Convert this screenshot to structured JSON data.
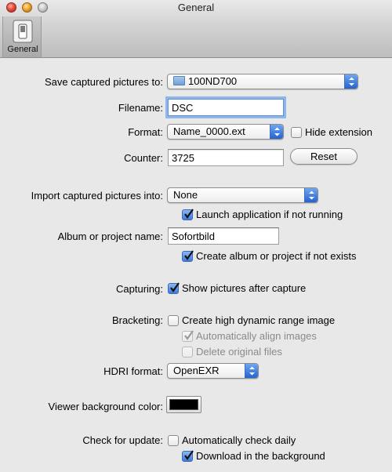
{
  "window": {
    "title": "General"
  },
  "toolbar": {
    "items": [
      {
        "label": "General",
        "icon": "toggle-switch-icon"
      }
    ]
  },
  "save": {
    "label": "Save captured pictures to:",
    "folder": "100ND700"
  },
  "filename": {
    "label": "Filename:",
    "value": "DSC"
  },
  "format": {
    "label": "Format:",
    "value": "Name_0000.ext",
    "hide_extension_label": "Hide extension",
    "hide_extension_checked": false
  },
  "counter": {
    "label": "Counter:",
    "value": "3725",
    "reset_label": "Reset"
  },
  "import": {
    "label": "Import captured pictures into:",
    "value": "None",
    "launch_label": "Launch application if not running",
    "launch_checked": true
  },
  "album": {
    "label": "Album or project name:",
    "value": "Sofortbild",
    "create_label": "Create album or project if not exists",
    "create_checked": true
  },
  "capturing": {
    "label": "Capturing:",
    "show_label": "Show pictures after capture",
    "show_checked": true
  },
  "bracketing": {
    "label": "Bracketing:",
    "hdr_label": "Create high dynamic range image",
    "hdr_checked": false,
    "align_label": "Automatically align images",
    "align_checked": true,
    "align_enabled": false,
    "delete_label": "Delete original files",
    "delete_checked": false,
    "delete_enabled": false
  },
  "hdri": {
    "label": "HDRI format:",
    "value": "OpenEXR"
  },
  "viewer": {
    "label": "Viewer background color:",
    "color": "#000000"
  },
  "update": {
    "label": "Check for update:",
    "daily_label": "Automatically check daily",
    "daily_checked": false,
    "download_label": "Download in the background",
    "download_checked": true
  },
  "colors": {
    "accent": "#3f7ad8",
    "focus_ring": "#8db6ee"
  }
}
